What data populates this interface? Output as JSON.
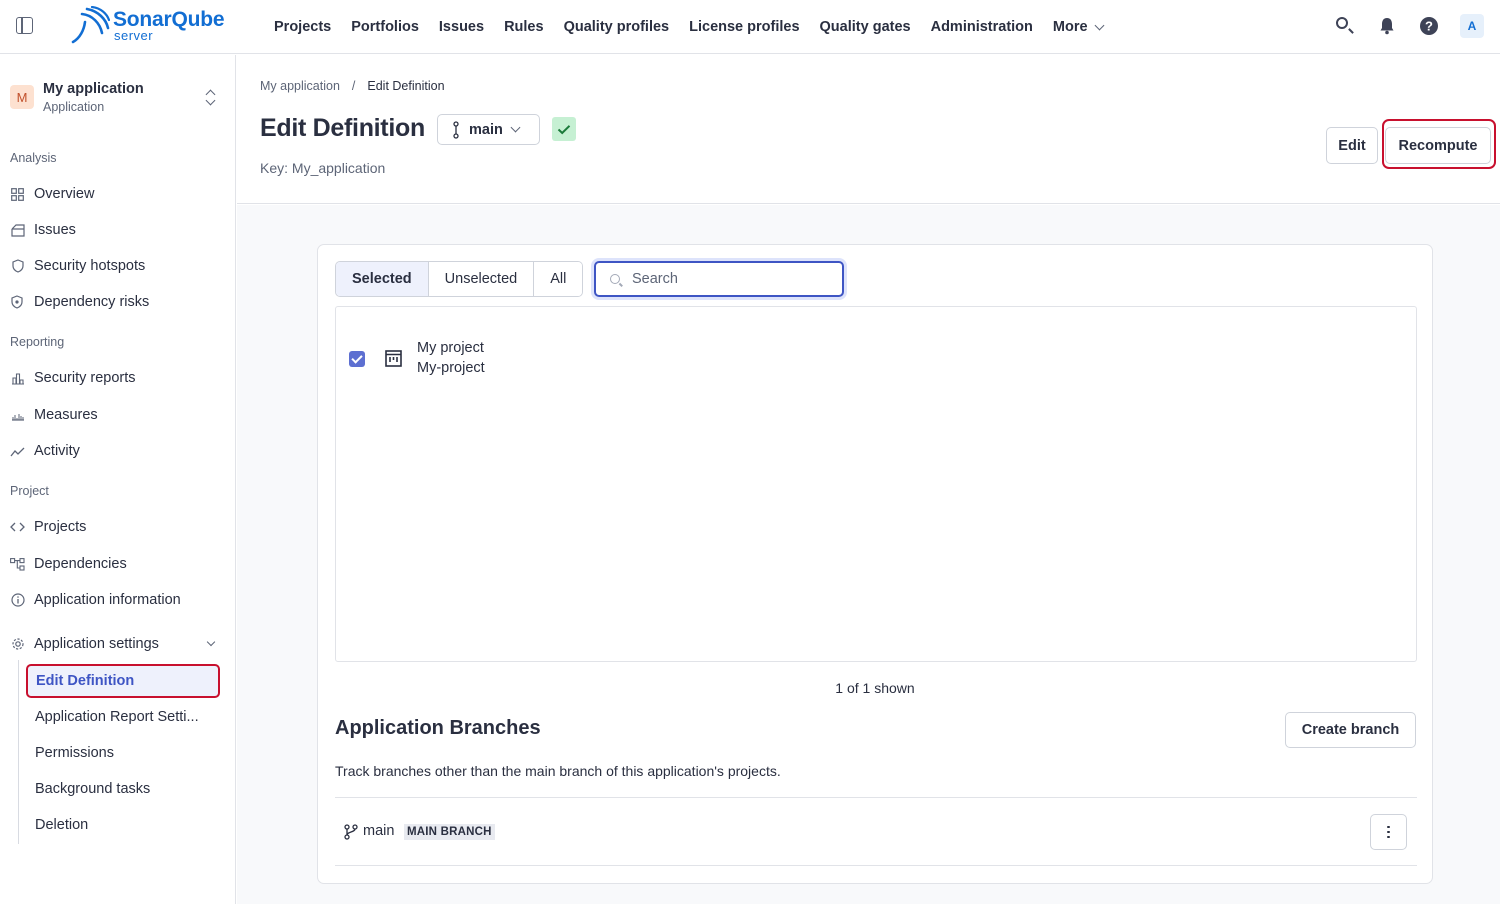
{
  "brand": {
    "name": "SonarQube",
    "sub": "server",
    "color": "#126ed3"
  },
  "nav": {
    "items": [
      "Projects",
      "Portfolios",
      "Issues",
      "Rules",
      "Quality profiles",
      "License profiles",
      "Quality gates",
      "Administration"
    ],
    "more": "More",
    "avatar": "A"
  },
  "sidebar": {
    "app_badge": "M",
    "app_name": "My application",
    "app_type": "Application",
    "sections": {
      "analysis": "Analysis",
      "reporting": "Reporting",
      "project": "Project"
    },
    "analysis_items": [
      "Overview",
      "Issues",
      "Security hotspots",
      "Dependency risks"
    ],
    "reporting_items": [
      "Security reports",
      "Measures",
      "Activity"
    ],
    "project_items": [
      "Projects",
      "Dependencies",
      "Application information"
    ],
    "settings_label": "Application settings",
    "settings_items": [
      "Edit Definition",
      "Application Report Setti...",
      "Permissions",
      "Background tasks",
      "Deletion"
    ]
  },
  "header": {
    "breadcrumb": [
      "My application",
      "/",
      "Edit Definition"
    ],
    "title": "Edit Definition",
    "branch": "main",
    "key_line": "Key: My_application",
    "edit_label": "Edit",
    "recompute_label": "Recompute"
  },
  "definition": {
    "filters": [
      "Selected",
      "Unselected",
      "All"
    ],
    "active_filter": "Selected",
    "search_placeholder": "Search",
    "projects": [
      {
        "name": "My project",
        "key": "My-project",
        "checked": true
      }
    ],
    "shown_text": "1 of 1 shown"
  },
  "branches": {
    "title": "Application Branches",
    "create_label": "Create branch",
    "description": "Track branches other than the main branch of this application's projects.",
    "rows": [
      {
        "name": "main",
        "badge": "MAIN BRANCH"
      }
    ]
  },
  "colors": {
    "accent": "#3e55c4",
    "highlight": "#c8102e",
    "ok": "#c6f0d3"
  }
}
